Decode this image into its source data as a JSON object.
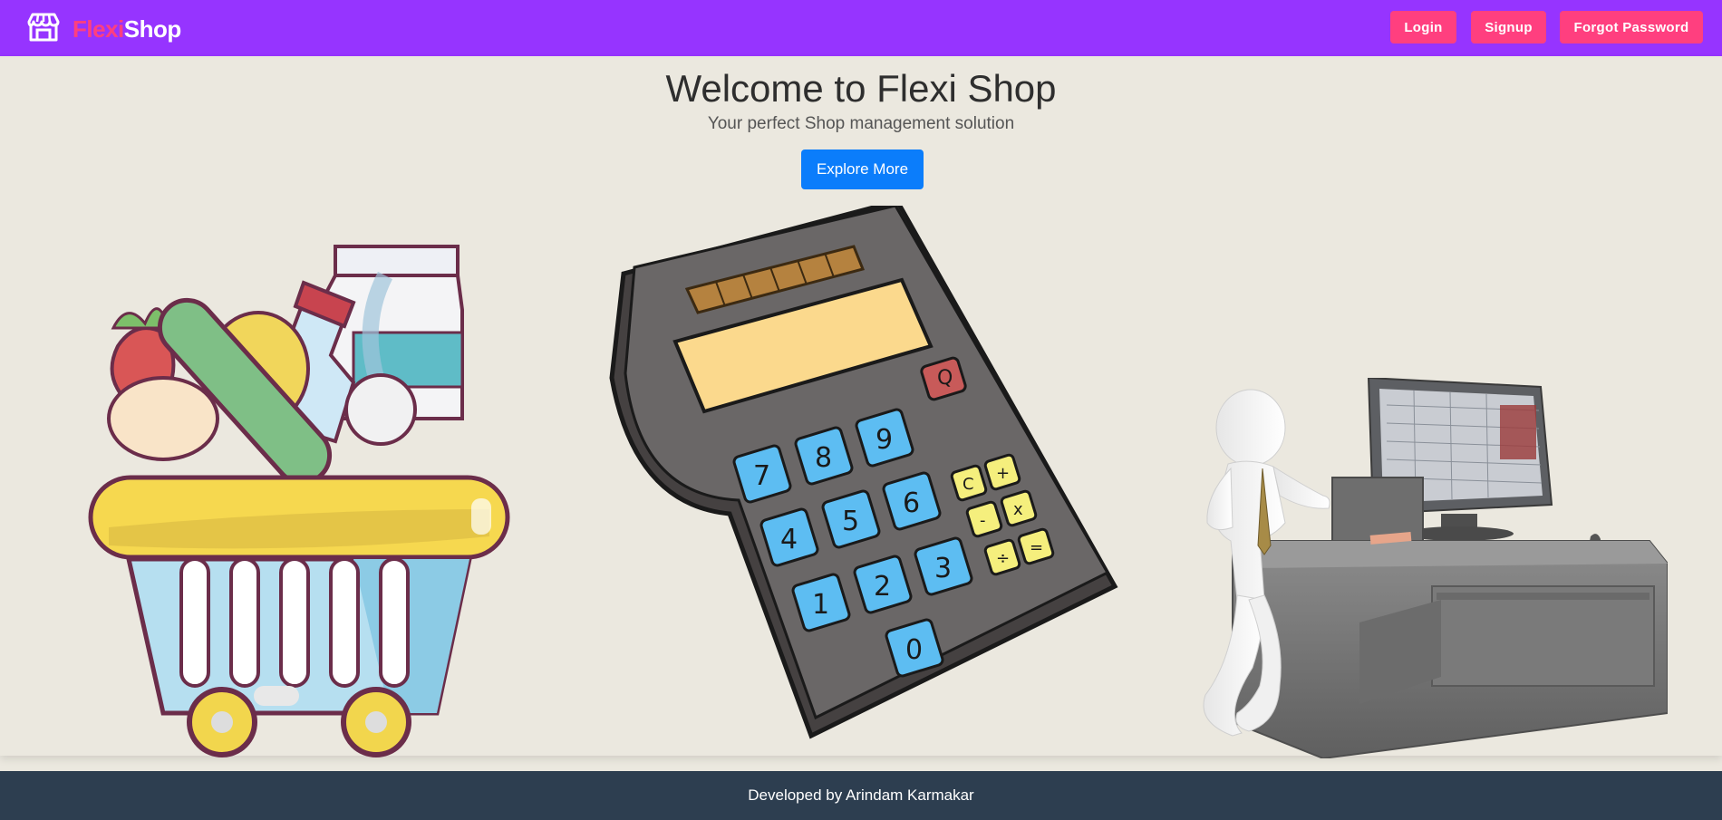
{
  "brand": {
    "accent": "Flexi",
    "main": "Shop",
    "icon": "store-icon",
    "colors": {
      "accent": "#ff3f7f",
      "main": "#ffffff"
    }
  },
  "nav": {
    "login_label": "Login",
    "signup_label": "Signup",
    "forgot_label": "Forgot Password",
    "bar_color": "#9634ff",
    "button_color": "#ff3f7f"
  },
  "hero": {
    "title": "Welcome to Flexi Shop",
    "subtitle": "Your perfect Shop management solution",
    "cta_label": "Explore More",
    "cta_color": "#0b7dfb",
    "illustrations": [
      "grocery-basket-illustration",
      "calculator-illustration",
      "cashier-counter-illustration"
    ]
  },
  "calculator": {
    "keys": [
      "7",
      "8",
      "9",
      "4",
      "5",
      "6",
      "1",
      "2",
      "3",
      "0",
      "C",
      "+",
      "-",
      "x",
      "÷",
      "="
    ],
    "power_key": "Q"
  },
  "footer": {
    "credit": "Developed by Arindam Karmakar",
    "color": "#2d3e50"
  }
}
